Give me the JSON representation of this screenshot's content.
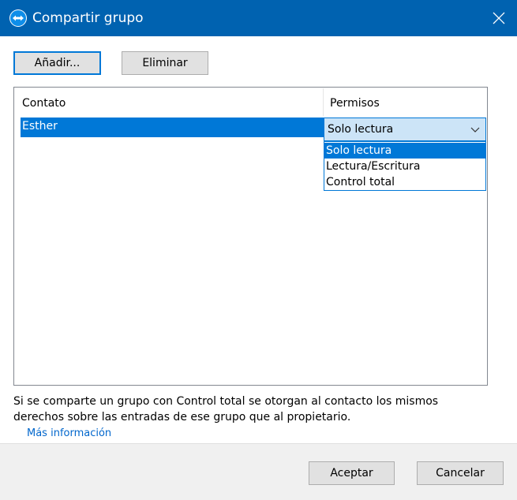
{
  "window": {
    "title": "Compartir grupo"
  },
  "toolbar": {
    "add_label": "Añadir...",
    "remove_label": "Eliminar"
  },
  "table": {
    "columns": [
      "Contato",
      "Permisos"
    ],
    "rows": [
      {
        "contact": "Esther",
        "permission": "Solo lectura"
      }
    ]
  },
  "dropdown": {
    "selected": "Solo lectura",
    "options": [
      "Solo lectura",
      "Lectura/Escritura",
      "Control total"
    ]
  },
  "info": {
    "line1": "Si se comparte un grupo con Control total se otorgan al contacto los mismos",
    "line2": "derechos sobre las entradas de ese grupo que al propietario.",
    "link": "Más información"
  },
  "footer": {
    "ok_label": "Aceptar",
    "cancel_label": "Cancelar"
  },
  "colors": {
    "titlebar": "#0062b0",
    "accent": "#0078d7",
    "combo_bg": "#cce4f7"
  }
}
